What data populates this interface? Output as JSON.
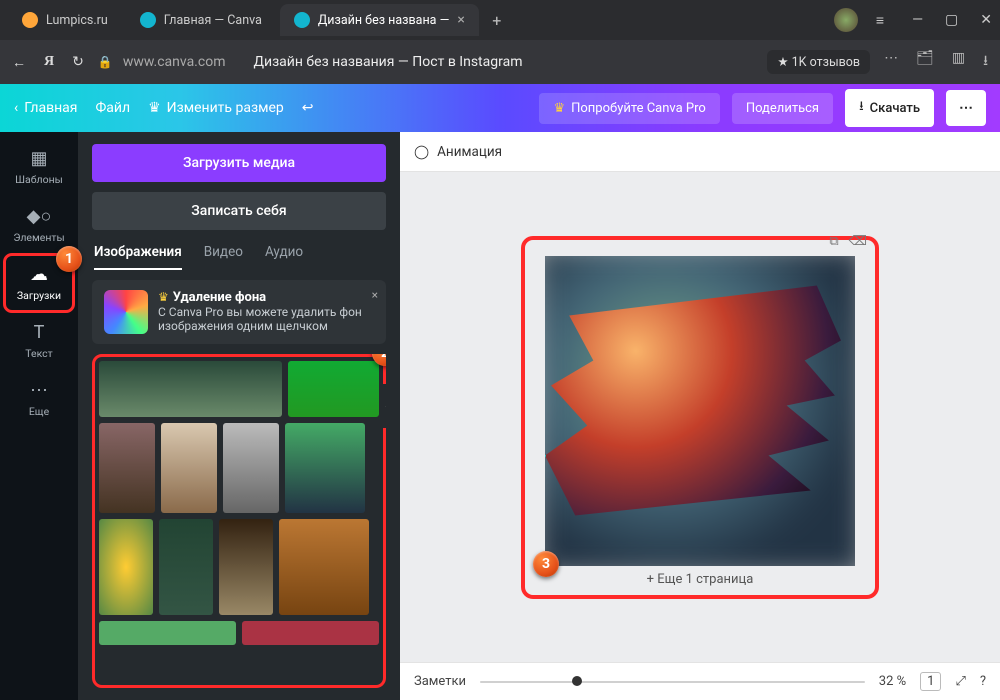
{
  "browser": {
    "tabs": [
      {
        "label": "Lumpics.ru",
        "favicon": "#ffa63a"
      },
      {
        "label": "Главная — Canva",
        "favicon": "#13b5cf"
      },
      {
        "label": "Дизайн без названа —",
        "favicon": "#13b5cf"
      }
    ],
    "url_host": "www.canva.com",
    "page_title": "Дизайн без названия — Пост в Instagram",
    "reviews": "★ 1K отзывов"
  },
  "canva_top": {
    "home": "Главная",
    "file": "Файл",
    "resize": "Изменить размер",
    "try_pro": "Попробуйте Canva Pro",
    "share": "Поделиться",
    "download": "Скачать"
  },
  "sidenav": {
    "templates": "Шаблоны",
    "elements": "Элементы",
    "uploads": "Загрузки",
    "text": "Текст",
    "more": "Еще"
  },
  "panel": {
    "upload_btn": "Загрузить медиа",
    "record_btn": "Записать себя",
    "tabs": {
      "images": "Изображения",
      "video": "Видео",
      "audio": "Аудио"
    },
    "promo": {
      "title": "Удаление фона",
      "desc": "С Canva Pro вы можете удалить фон изображения одним щелчком"
    }
  },
  "canvas": {
    "toolbar_animation": "Анимация",
    "add_page": "+ Еще 1 страница",
    "notes": "Заметки",
    "zoom": "32 %",
    "page_indicator": "1"
  }
}
